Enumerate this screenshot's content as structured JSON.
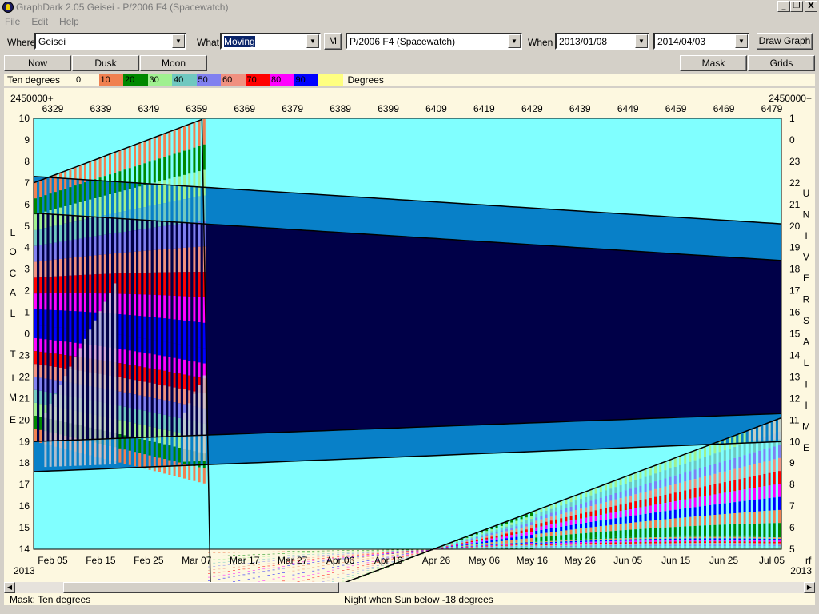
{
  "window": {
    "title": "GraphDark 2.05  Geisei  -  P/2006 F4 (Spacewatch)",
    "minimize": "_",
    "restore": "❐",
    "close": "X"
  },
  "menu": [
    "File",
    "Edit",
    "Help"
  ],
  "toolbar": {
    "where_label": "Where",
    "where_value": "Geisei",
    "what_label": "What",
    "what_value": "Moving",
    "m_button": "M",
    "object_value": "P/2006 F4 (Spacewatch)",
    "when_label": "When",
    "start_date": "2013/01/08",
    "end_date": "2014/04/03",
    "draw_graph": "Draw Graph"
  },
  "tabs": {
    "now": "Now",
    "dusk": "Dusk",
    "moon": "Moon",
    "mask": "Mask",
    "grids": "Grids"
  },
  "legend": {
    "title": "Ten degrees",
    "units": "Degrees",
    "items": [
      {
        "label": "0",
        "color": "#fdf8e0"
      },
      {
        "label": "10",
        "color": "#f08050"
      },
      {
        "label": "20",
        "color": "#008800"
      },
      {
        "label": "30",
        "color": "#a0f090"
      },
      {
        "label": "40",
        "color": "#70c8c0"
      },
      {
        "label": "50",
        "color": "#8080f0"
      },
      {
        "label": "60",
        "color": "#f09080"
      },
      {
        "label": "70",
        "color": "#ff0000"
      },
      {
        "label": "80",
        "color": "#ff00ff"
      },
      {
        "label": "90",
        "color": "#0000ff"
      },
      {
        "label": "",
        "color": "#ffff80"
      }
    ]
  },
  "chart": {
    "jd_prefix_left": "2450000+",
    "jd_prefix_right": "2450000+",
    "jd_ticks": [
      "6329",
      "6339",
      "6349",
      "6359",
      "6369",
      "6379",
      "6389",
      "6399",
      "6409",
      "6419",
      "6429",
      "6439",
      "6449",
      "6459",
      "6469",
      "6479"
    ],
    "date_ticks": [
      "Feb 05",
      "Feb 15",
      "Feb 25",
      "Mar 07",
      "Mar 17",
      "Mar 27",
      "Apr 06",
      "Apr 16",
      "Apr 26",
      "May 06",
      "May 16",
      "May 26",
      "Jun 05",
      "Jun 15",
      "Jun 25",
      "Jul 05"
    ],
    "year_left": "2013",
    "year_right": "2013",
    "rf_label": "rf",
    "local_axis_label": "LOCAL TIME",
    "universal_axis_label": "UNIVERSAL TIME",
    "local_hours": [
      "10",
      "9",
      "8",
      "7",
      "6",
      "5",
      "4",
      "3",
      "2",
      "1",
      "0",
      "23",
      "22",
      "21",
      "20",
      "19",
      "18",
      "17",
      "16",
      "15",
      "14"
    ],
    "ut_hours": [
      "1",
      "0",
      "23",
      "22",
      "21",
      "20",
      "19",
      "18",
      "17",
      "16",
      "15",
      "14",
      "13",
      "12",
      "11",
      "10",
      "9",
      "8",
      "7",
      "6",
      "5"
    ],
    "colors": {
      "day": "#80ffff",
      "twilight": "#0880c8",
      "night": "#000048",
      "moon": "#c8c8d0"
    }
  },
  "chart_data": {
    "type": "heatmap",
    "x_axis": "Date (Julian Day 2450000+)",
    "x_range": [
      "2013-02-01",
      "2013-07-07"
    ],
    "jd_range": [
      6325,
      6481
    ],
    "y_axis_left": "Local time (hours)",
    "y_axis_right": "Universal time (hours)",
    "y_range_local": [
      10,
      14
    ],
    "altitude_bands_deg": [
      0,
      10,
      20,
      30,
      40,
      50,
      60,
      70,
      80,
      90
    ],
    "object_rise_local": [
      [
        6325,
        19.0
      ],
      [
        6481,
        10.4
      ]
    ],
    "object_set_local": [
      [
        6325,
        7.0
      ],
      [
        6481,
        20.1
      ]
    ],
    "sunset_local": [
      [
        6325,
        17.6
      ],
      [
        6481,
        19.0
      ]
    ],
    "sunrise_local": [
      [
        6325,
        7.3
      ],
      [
        6481,
        5.1
      ]
    ],
    "dark_start_local": [
      [
        6325,
        19.0
      ],
      [
        6481,
        20.3
      ]
    ],
    "dark_end_local": [
      [
        6325,
        5.6
      ],
      [
        6481,
        3.4
      ]
    ]
  },
  "status": {
    "mask": "Mask:  Ten degrees",
    "night": "Night when Sun below -18 degrees"
  }
}
